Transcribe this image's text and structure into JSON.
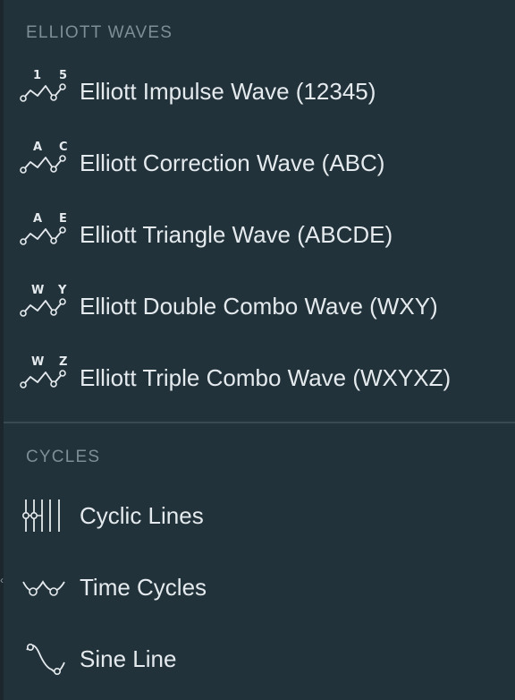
{
  "sections": [
    {
      "header": "ELLIOTT WAVES",
      "items": [
        {
          "label": "Elliott Impulse Wave (12345)",
          "icon": "elliott-impulse-wave-icon",
          "marks": [
            "1",
            "5"
          ]
        },
        {
          "label": "Elliott Correction Wave (ABC)",
          "icon": "elliott-correction-wave-icon",
          "marks": [
            "A",
            "C"
          ]
        },
        {
          "label": "Elliott Triangle Wave (ABCDE)",
          "icon": "elliott-triangle-wave-icon",
          "marks": [
            "A",
            "E"
          ]
        },
        {
          "label": "Elliott Double Combo Wave (WXY)",
          "icon": "elliott-double-combo-wave-icon",
          "marks": [
            "W",
            "Y"
          ]
        },
        {
          "label": "Elliott Triple Combo Wave (WXYXZ)",
          "icon": "elliott-triple-combo-wave-icon",
          "marks": [
            "W",
            "Z"
          ]
        }
      ]
    },
    {
      "header": "CYCLES",
      "items": [
        {
          "label": "Cyclic Lines",
          "icon": "cyclic-lines-icon"
        },
        {
          "label": "Time Cycles",
          "icon": "time-cycles-icon"
        },
        {
          "label": "Sine Line",
          "icon": "sine-line-icon"
        }
      ]
    }
  ],
  "colors": {
    "background": "#22323a",
    "text": "#e4eaed",
    "header": "#7e8e97",
    "divider": "#3a4a52"
  }
}
